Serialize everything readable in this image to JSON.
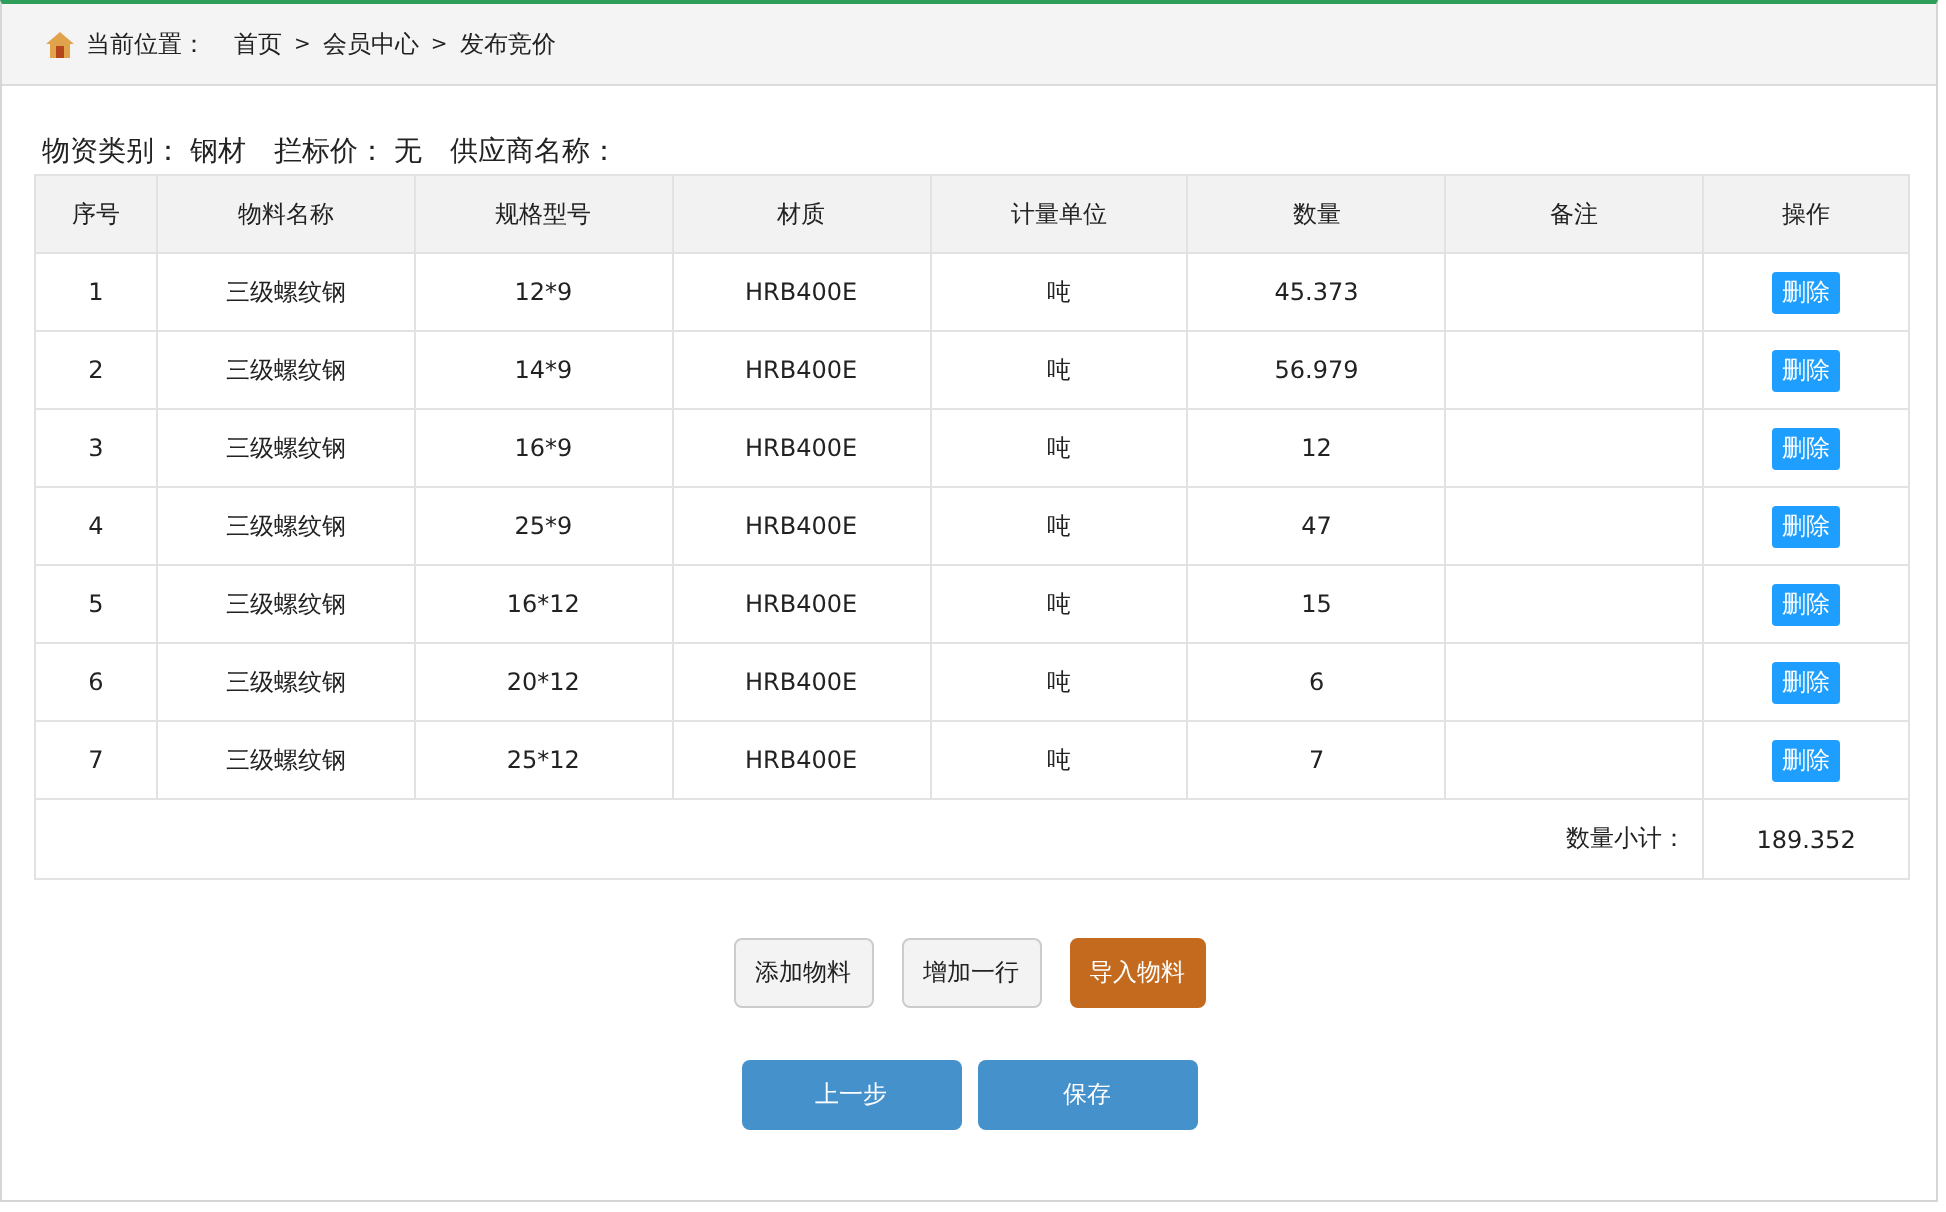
{
  "breadcrumb": {
    "label": "当前位置：",
    "path": [
      {
        "kind": "link",
        "text": "首页"
      },
      {
        "kind": "separator",
        "text": ">"
      },
      {
        "kind": "link",
        "text": "会员中心"
      },
      {
        "kind": "separator",
        "text": ">"
      },
      {
        "kind": "current",
        "text": "发布竞价"
      }
    ]
  },
  "info": [
    {
      "label": "物资类别：",
      "value": "钢材"
    },
    {
      "label": "拦标价：",
      "value": "无"
    },
    {
      "label": "供应商名称："
    }
  ],
  "table": {
    "columns": [
      "序号",
      "物料名称",
      "规格型号",
      "材质",
      "计量单位",
      "数量",
      "备注",
      "操作"
    ],
    "rows": [
      {
        "cells": [
          "1",
          "三级螺纹钢",
          "12*9",
          "HRB400E",
          "吨",
          "45.373",
          ""
        ],
        "action": "删除"
      },
      {
        "cells": [
          "2",
          "三级螺纹钢",
          "14*9",
          "HRB400E",
          "吨",
          "56.979",
          ""
        ],
        "action": "删除"
      },
      {
        "cells": [
          "3",
          "三级螺纹钢",
          "16*9",
          "HRB400E",
          "吨",
          "12",
          ""
        ],
        "action": "删除"
      },
      {
        "cells": [
          "4",
          "三级螺纹钢",
          "25*9",
          "HRB400E",
          "吨",
          "47",
          ""
        ],
        "action": "删除"
      },
      {
        "cells": [
          "5",
          "三级螺纹钢",
          "16*12",
          "HRB400E",
          "吨",
          "15",
          ""
        ],
        "action": "删除"
      },
      {
        "cells": [
          "6",
          "三级螺纹钢",
          "20*12",
          "HRB400E",
          "吨",
          "6",
          ""
        ],
        "action": "删除"
      },
      {
        "cells": [
          "7",
          "三级螺纹钢",
          "25*12",
          "HRB400E",
          "吨",
          "7",
          ""
        ],
        "action": "删除"
      }
    ],
    "subtotal": {
      "label": "数量小计：",
      "value": "189.352"
    }
  },
  "tool_buttons": [
    {
      "label": "添加物料",
      "kind": "plain"
    },
    {
      "label": "增加一行",
      "kind": "plain"
    },
    {
      "label": "导入物料",
      "kind": "accent"
    }
  ],
  "step_buttons": [
    {
      "label": "上一步",
      "kind": "primary"
    },
    {
      "label": "保存",
      "kind": "primary"
    }
  ]
}
